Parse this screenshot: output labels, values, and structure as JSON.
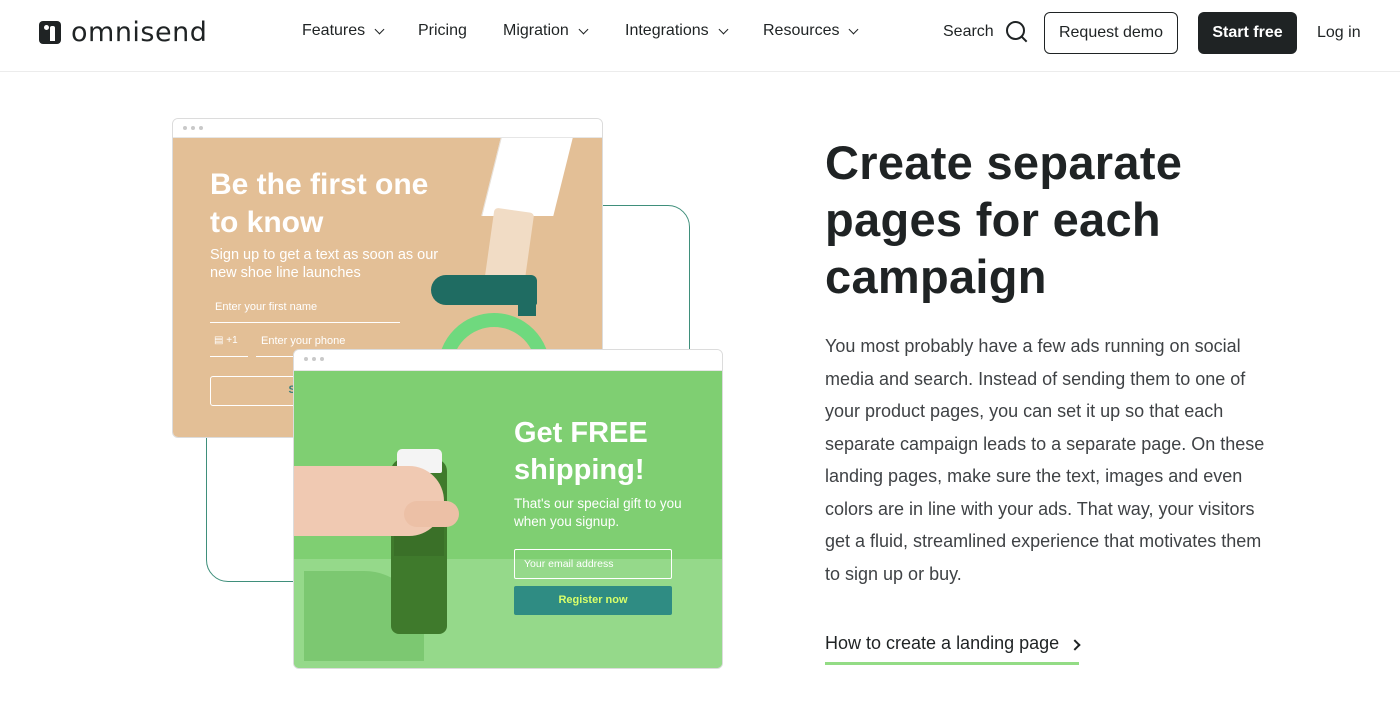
{
  "header": {
    "logo_text": "omnisend",
    "nav": [
      {
        "label": "Features",
        "dropdown": true
      },
      {
        "label": "Pricing",
        "dropdown": false
      },
      {
        "label": "Migration",
        "dropdown": true
      },
      {
        "label": "Integrations",
        "dropdown": true
      },
      {
        "label": "Resources",
        "dropdown": true
      }
    ],
    "search_label": "Search",
    "request_demo_label": "Request demo",
    "start_free_label": "Start free",
    "login_label": "Log in"
  },
  "illustration": {
    "window1": {
      "title": "Be the first one to know",
      "subtitle": "Sign up to get a text as soon as our new shoe line launches",
      "first_name_placeholder": "Enter your first name",
      "country_code": "+1",
      "phone_placeholder": "Enter your phone",
      "button_label": "Subsc"
    },
    "window2": {
      "title": "Get FREE shipping!",
      "subtitle": "That's our special gift to you when you signup.",
      "email_placeholder": "Your email address",
      "button_label": "Register now"
    }
  },
  "content": {
    "heading": "Create separate pages for each campaign",
    "paragraph": "You most probably have a few ads running on social media and search. Instead of sending them to one of your product pages, you can set it up so that each separate campaign leads to a separate page. On these landing pages, make sure the text, images and even colors are in line with your ads. That way, your visitors get a fluid, streamlined experience that motivates them to sign up or buy.",
    "cta_label": "How to create a landing page"
  },
  "colors": {
    "dark": "#1f2324",
    "accent_green": "#93dc85",
    "teal": "#2f8c83",
    "beige": "#e3bf96",
    "green": "#7fcf72"
  },
  "icons": [
    "chevron-down-icon",
    "search-icon",
    "chevron-right-icon"
  ]
}
